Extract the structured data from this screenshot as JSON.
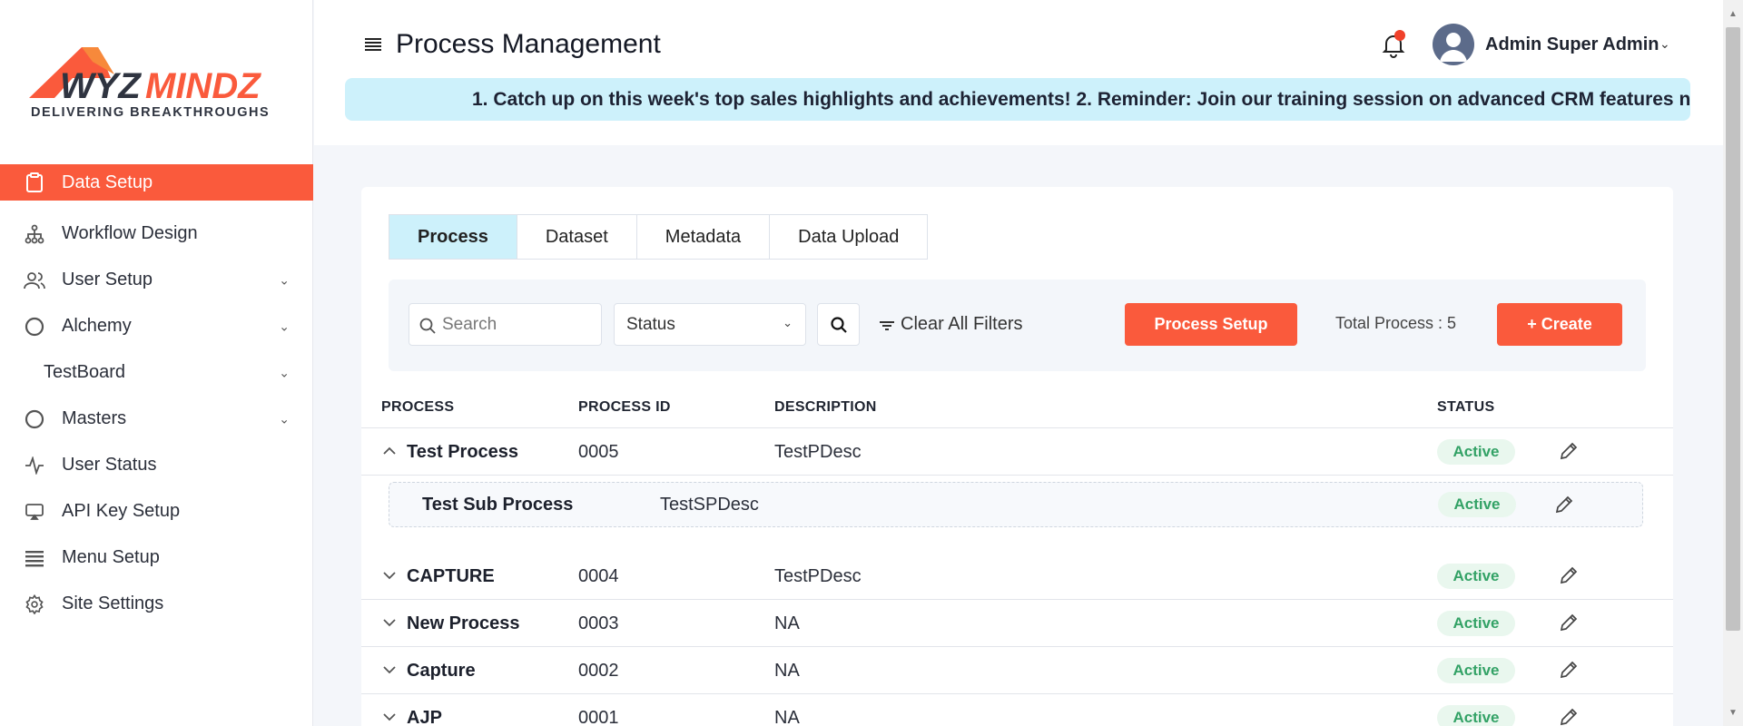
{
  "brand": {
    "logo_text_a": "WYZ",
    "logo_text_b": "MINDZ",
    "tagline": "DELIVERING  BREAKTHROUGHS",
    "accent": "#fa5a3c"
  },
  "sidebar": {
    "items": [
      {
        "label": "Data Setup",
        "icon": "clipboard-icon",
        "active": true
      },
      {
        "label": "Workflow Design",
        "icon": "hierarchy-icon"
      },
      {
        "label": "User Setup",
        "icon": "users-icon",
        "chevron": true
      },
      {
        "label": "Alchemy",
        "icon": "circle-icon",
        "chevron": true
      },
      {
        "label": "TestBoard",
        "chevron": true
      },
      {
        "label": "Masters",
        "icon": "circle-icon",
        "chevron": true
      },
      {
        "label": "User Status",
        "icon": "activity-icon"
      },
      {
        "label": "API Key Setup",
        "icon": "cast-icon"
      },
      {
        "label": "Menu Setup",
        "icon": "list-icon"
      },
      {
        "label": "Site Settings",
        "icon": "gear-icon"
      }
    ]
  },
  "header": {
    "title": "Process Management",
    "user_name": "Admin Super Admin",
    "announcement": "1. Catch up on this week's top sales highlights and achievements! 2. Reminder: Join our training session on advanced CRM features n"
  },
  "tabs": [
    {
      "label": "Process",
      "active": true
    },
    {
      "label": "Dataset"
    },
    {
      "label": "Metadata"
    },
    {
      "label": "Data Upload"
    }
  ],
  "filters": {
    "search_placeholder": "Search",
    "status_label": "Status",
    "clear_label": "Clear All Filters",
    "process_setup_label": "Process Setup",
    "total_label": "Total Process : 5",
    "create_label": "+ Create"
  },
  "table": {
    "headers": {
      "process": "PROCESS",
      "process_id": "PROCESS ID",
      "description": "DESCRIPTION",
      "status": "STATUS"
    },
    "rows": [
      {
        "name": "Test Process",
        "id": "0005",
        "description": "TestPDesc",
        "status": "Active",
        "expanded": true
      },
      {
        "name": "CAPTURE",
        "id": "0004",
        "description": "TestPDesc",
        "status": "Active"
      },
      {
        "name": "New Process",
        "id": "0003",
        "description": "NA",
        "status": "Active"
      },
      {
        "name": "Capture",
        "id": "0002",
        "description": "NA",
        "status": "Active"
      },
      {
        "name": "AJP",
        "id": "0001",
        "description": "NA",
        "status": "Active"
      }
    ],
    "sub_row": {
      "name": "Test Sub Process",
      "description": "TestSPDesc",
      "status": "Active"
    }
  }
}
